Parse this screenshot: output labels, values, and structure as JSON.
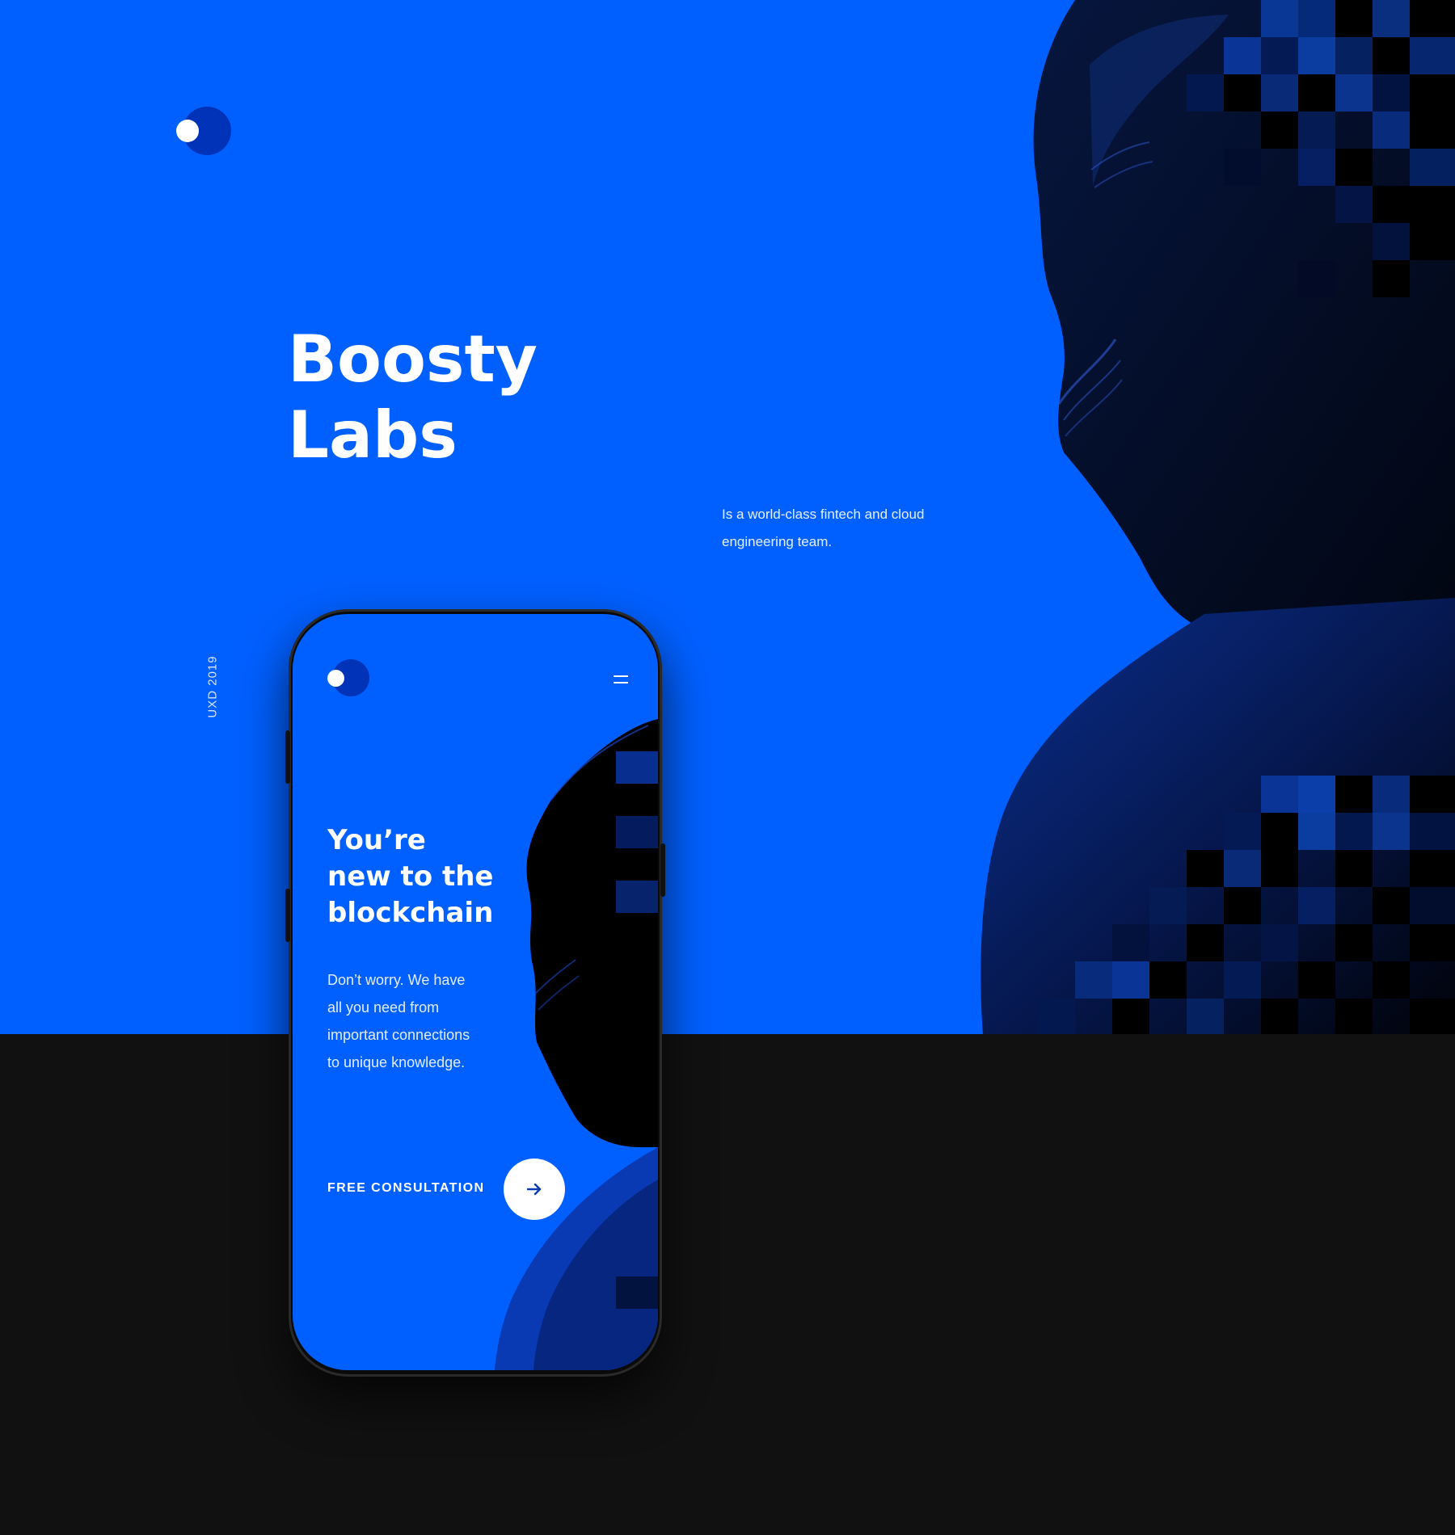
{
  "hero": {
    "title_line1": "Boosty",
    "title_line2": "Labs",
    "description": "Is a world-class fintech and cloud engineering team.",
    "vertical_label": "UXD 2019"
  },
  "phone": {
    "headline_line1": "You’re",
    "headline_line2": "new to the",
    "headline_line3": "blockchain",
    "body_line1": "Don’t worry. We have",
    "body_line2": "all you need from",
    "body_line3": "important connections",
    "body_line4": "to unique knowledge.",
    "cta_label": "FREE CONSULTATION"
  },
  "colors": {
    "brand_blue": "#0060ff",
    "dark_blue": "#0033b8",
    "background_dark": "#111111",
    "text_white": "#ffffff"
  },
  "icons": {
    "logo": "logo-icon",
    "menu": "hamburger-menu-icon",
    "cta_arrow": "arrow-right-icon"
  }
}
